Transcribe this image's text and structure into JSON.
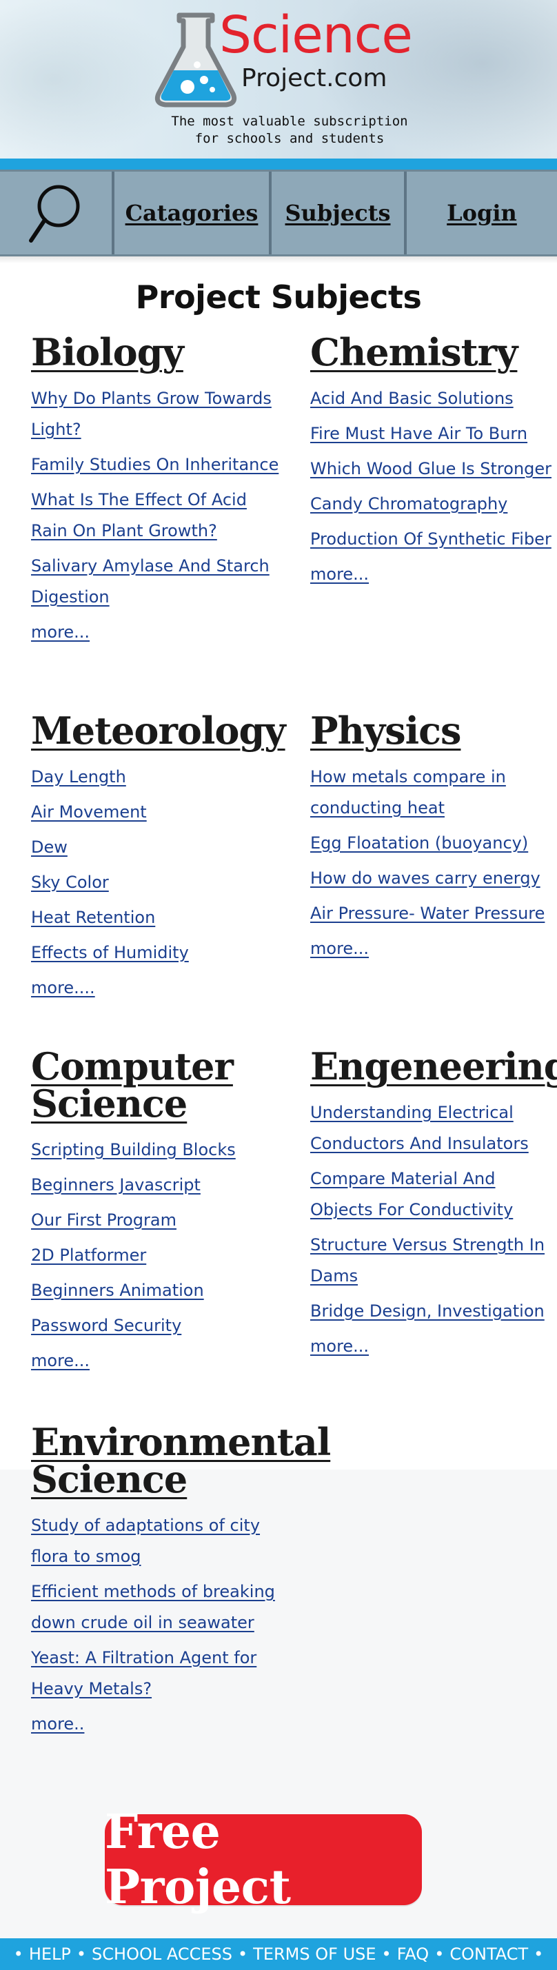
{
  "header": {
    "logo_science": "Science",
    "logo_domain": "Project.com",
    "tagline_line1": "The most valuable subscription",
    "tagline_line2": "for schools and students"
  },
  "nav": {
    "categories": "Catagories",
    "subjects": "Subjects",
    "login": "Login",
    "search_icon": "search-icon"
  },
  "page_title": "Project Subjects",
  "sections": [
    {
      "title": "Biology",
      "links": [
        "Why Do Plants Grow Towards Light?",
        "Family Studies On Inheritance",
        "What Is The Effect Of Acid Rain On Plant Growth?",
        "Salivary Amylase And Starch Digestion "
      ],
      "more": "more..."
    },
    {
      "title": "Chemistry",
      "links": [
        "Acid And Basic Solutions",
        "Fire Must Have Air To Burn",
        "Which Wood Glue Is Stronger",
        "Candy Chromatography ",
        "Production Of Synthetic Fiber"
      ],
      "more": "more..."
    },
    {
      "title": "Meteorology",
      "links": [
        "Day Length",
        "Air Movement",
        "Dew",
        "Sky Color",
        "Heat Retention",
        "Effects of Humidity"
      ],
      "more": "more...."
    },
    {
      "title": "Physics",
      "links": [
        "How metals compare in conducting heat",
        "Egg Floatation (buoyancy)",
        "How do waves carry energy ",
        "Air Pressure- Water Pressure "
      ],
      "more": "more..."
    },
    {
      "title": "Computer Science",
      "links": [
        "Scripting Building Blocks",
        "Beginners Javascript",
        "Our First Program",
        "2D Platformer",
        "Beginners Animation",
        "Password Security"
      ],
      "more": "more..."
    },
    {
      "title": "Engeneering",
      "links": [
        "Understanding Electrical Conductors And Insulators",
        "Compare Material And Objects For Conductivity",
        "Structure Versus Strength In Dams ",
        "Bridge Design, Investigation"
      ],
      "more": "more..."
    },
    {
      "title": "Environmental Science",
      "links": [
        "Study of adaptations of city flora to smog ",
        "Efficient methods of breaking down crude oil in seawater",
        "Yeast: A Filtration Agent for Heavy Metals?"
      ],
      "more": "more.."
    }
  ],
  "cta": "Free Project",
  "footer": {
    "items": [
      "HELP",
      "SCHOOL ACCESS",
      "TERMS OF USE",
      "FAQ",
      "CONTACT"
    ],
    "separator": "•"
  },
  "colors": {
    "brand_red": "#e3232d",
    "brand_blue": "#1fa3de",
    "nav_bg": "#8ea8b8",
    "link": "#1b3f8f"
  }
}
